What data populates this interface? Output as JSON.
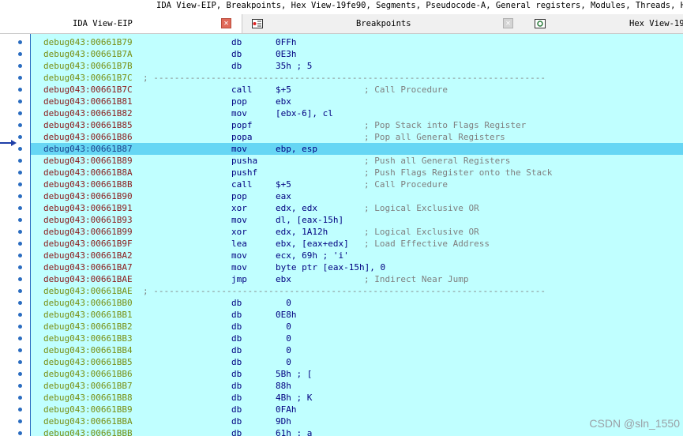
{
  "title": "IDA View-EIP, Breakpoints, Hex View-19fe90, Segments, Pseudocode-A, General registers, Modules, Threads, Hex Vi",
  "tabs": [
    {
      "label": "IDA View-EIP",
      "icon": "close-icon"
    },
    {
      "label": "Breakpoints",
      "icon": "breakpoints-icon"
    },
    {
      "label": "Hex View-19",
      "icon": "hex-view-icon"
    }
  ],
  "rows": [
    {
      "addr": "debug043:00661B79",
      "mn": "db",
      "op": "0FFh",
      "cmt": "",
      "type": "data"
    },
    {
      "addr": "debug043:00661B7A",
      "mn": "db",
      "op": "0E3h",
      "cmt": "",
      "type": "data"
    },
    {
      "addr": "debug043:00661B7B",
      "mn": "db",
      "op": "35h ; 5",
      "cmt": "",
      "type": "data"
    },
    {
      "addr": "debug043:00661B7C",
      "sep": "; ---------------------------------------------------------------------------",
      "type": "sep"
    },
    {
      "addr": "debug043:00661B7C",
      "mn": "call",
      "op": "$+5",
      "cmt": "; Call Procedure",
      "type": "code"
    },
    {
      "addr": "debug043:00661B81",
      "mn": "pop",
      "op": "ebx",
      "cmt": "",
      "type": "code"
    },
    {
      "addr": "debug043:00661B82",
      "mn": "mov",
      "op": "[ebx-6], cl",
      "cmt": "",
      "type": "code"
    },
    {
      "addr": "debug043:00661B85",
      "mn": "popf",
      "op": "",
      "cmt": "; Pop Stack into Flags Register",
      "type": "code"
    },
    {
      "addr": "debug043:00661B86",
      "mn": "popa",
      "op": "",
      "cmt": "; Pop all General Registers",
      "type": "code"
    },
    {
      "addr": "debug043:00661B87",
      "mn": "mov",
      "op": "ebp, esp",
      "cmt": "",
      "type": "code",
      "hl": true
    },
    {
      "addr": "debug043:00661B89",
      "mn": "pusha",
      "op": "",
      "cmt": "; Push all General Registers",
      "type": "code"
    },
    {
      "addr": "debug043:00661B8A",
      "mn": "pushf",
      "op": "",
      "cmt": "; Push Flags Register onto the Stack",
      "type": "code"
    },
    {
      "addr": "debug043:00661B8B",
      "mn": "call",
      "op": "$+5",
      "cmt": "; Call Procedure",
      "type": "code"
    },
    {
      "addr": "debug043:00661B90",
      "mn": "pop",
      "op": "eax",
      "cmt": "",
      "type": "code"
    },
    {
      "addr": "debug043:00661B91",
      "mn": "xor",
      "op": "edx, edx",
      "cmt": "; Logical Exclusive OR",
      "type": "code"
    },
    {
      "addr": "debug043:00661B93",
      "mn": "mov",
      "op": "dl, [eax-15h]",
      "cmt": "",
      "type": "code"
    },
    {
      "addr": "debug043:00661B99",
      "mn": "xor",
      "op": "edx, 1A12h",
      "cmt": "; Logical Exclusive OR",
      "type": "code"
    },
    {
      "addr": "debug043:00661B9F",
      "mn": "lea",
      "op": "ebx, [eax+edx]",
      "cmt": "; Load Effective Address",
      "type": "code"
    },
    {
      "addr": "debug043:00661BA2",
      "mn": "mov",
      "op": "ecx, 69h ; 'i'",
      "cmt": "",
      "type": "code"
    },
    {
      "addr": "debug043:00661BA7",
      "mn": "mov",
      "op": "byte ptr [eax-15h], 0",
      "cmt": "",
      "type": "code"
    },
    {
      "addr": "debug043:00661BAE",
      "mn": "jmp",
      "op": "ebx",
      "cmt": "; Indirect Near Jump",
      "type": "code"
    },
    {
      "addr": "debug043:00661BAE",
      "sep": "; ---------------------------------------------------------------------------",
      "type": "sep"
    },
    {
      "addr": "debug043:00661BB0",
      "mn": "db",
      "op": "  0",
      "cmt": "",
      "type": "data"
    },
    {
      "addr": "debug043:00661BB1",
      "mn": "db",
      "op": "0E8h",
      "cmt": "",
      "type": "data"
    },
    {
      "addr": "debug043:00661BB2",
      "mn": "db",
      "op": "  0",
      "cmt": "",
      "type": "data"
    },
    {
      "addr": "debug043:00661BB3",
      "mn": "db",
      "op": "  0",
      "cmt": "",
      "type": "data"
    },
    {
      "addr": "debug043:00661BB4",
      "mn": "db",
      "op": "  0",
      "cmt": "",
      "type": "data"
    },
    {
      "addr": "debug043:00661BB5",
      "mn": "db",
      "op": "  0",
      "cmt": "",
      "type": "data"
    },
    {
      "addr": "debug043:00661BB6",
      "mn": "db",
      "op": "5Bh ; [",
      "cmt": "",
      "type": "data"
    },
    {
      "addr": "debug043:00661BB7",
      "mn": "db",
      "op": "88h",
      "cmt": "",
      "type": "data"
    },
    {
      "addr": "debug043:00661BB8",
      "mn": "db",
      "op": "4Bh ; K",
      "cmt": "",
      "type": "data"
    },
    {
      "addr": "debug043:00661BB9",
      "mn": "db",
      "op": "0FAh",
      "cmt": "",
      "type": "data"
    },
    {
      "addr": "debug043:00661BBA",
      "mn": "db",
      "op": "9Dh",
      "cmt": "",
      "type": "data"
    },
    {
      "addr": "debug043:00661BBB",
      "mn": "db",
      "op": "61h ; a",
      "cmt": "",
      "type": "data"
    }
  ],
  "watermark": "CSDN @sln_1550",
  "colors": {
    "listing_bg": "#c0ffff",
    "highlight": "#66d6f4",
    "addr_data": "#788f12",
    "addr_code": "#8b1a1a"
  }
}
